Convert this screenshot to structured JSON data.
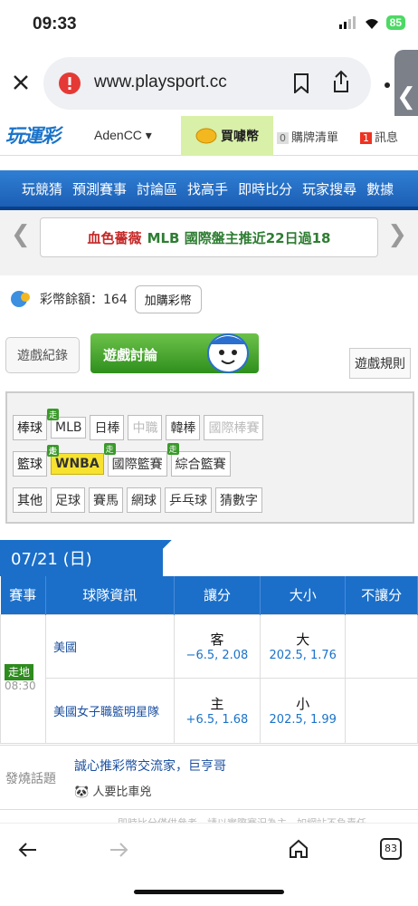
{
  "status": {
    "time": "09:33",
    "battery": "85"
  },
  "browser": {
    "url": "www.playsport.cc",
    "tab_count": "83"
  },
  "site": {
    "logo": "玩運彩",
    "user": "AdenCC ▾",
    "buy_coin": "買噱幣",
    "cart_count": "0",
    "cart_label": "購牌清單",
    "msg_count": "1",
    "msg_label": "訊息"
  },
  "nav": [
    "玩競猜",
    "預測賽事",
    "討論區",
    "找高手",
    "即時比分",
    "玩家搜尋",
    "數據"
  ],
  "banner": {
    "prefix": "血色薔薇",
    "text": "MLB 國際盤主推近22日過18"
  },
  "coins": {
    "label": "彩幣餘額：164",
    "button": "加購彩幣"
  },
  "tabs": {
    "record": "遊戲紀錄",
    "forum": "遊戲討論",
    "rules": "遊戲規則"
  },
  "filters": {
    "baseball": {
      "cat": "棒球",
      "items": [
        "MLB",
        "日棒",
        "中職",
        "韓棒",
        "國際棒賽"
      ]
    },
    "basketball": {
      "cat": "籃球",
      "items": [
        "WNBA",
        "國際籃賽",
        "綜合籃賽"
      ]
    },
    "other": {
      "cat": "其他",
      "items": [
        "足球",
        "賽馬",
        "網球",
        "乒乓球",
        "猜數字"
      ]
    },
    "live_tag": "走"
  },
  "date": "07/21 (日)",
  "table": {
    "headers": [
      "賽事",
      "球隊資訊",
      "讓分",
      "大小",
      "不讓分"
    ],
    "status": "走地",
    "game_time": "08:30",
    "rows": [
      {
        "team": "美國",
        "spread_main": "客",
        "spread_odds": "−6.5, 2.08",
        "total_main": "大",
        "total_odds": "202.5, 1.76"
      },
      {
        "team": "美國女子職籃明星隊",
        "spread_main": "主",
        "spread_odds": "+6.5, 1.68",
        "total_main": "小",
        "total_odds": "202.5, 1.99"
      }
    ]
  },
  "hot": {
    "label": "發燒話題",
    "title": "誠心推彩幣交流家，巨亨哥",
    "sub": "人要比車兇"
  },
  "disclaimer": "即時比分僅供參考，請以實際賽況為主，如網站不負責任"
}
